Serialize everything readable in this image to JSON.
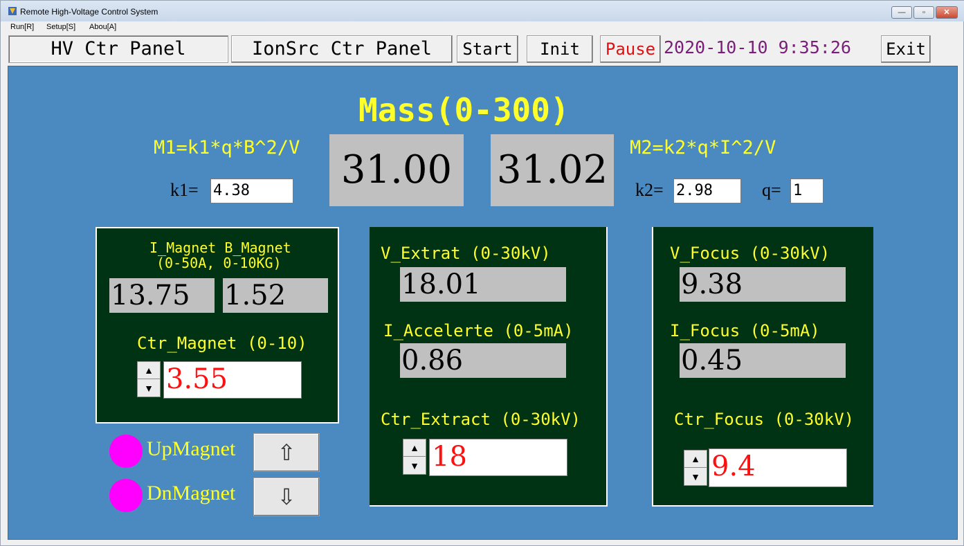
{
  "window": {
    "title": "Remote High-Voltage Control System",
    "minimize": "—",
    "maximize": "▫",
    "close": "✕"
  },
  "menu": [
    "Run[R]",
    "Setup[S]",
    "Abou[A]"
  ],
  "toolbar": {
    "hv_panel": "HV Ctr Panel",
    "ionsrc_panel": "IonSrc Ctr Panel",
    "start": "Start",
    "init": "Init",
    "pause": "Pause",
    "datetime": "2020-10-10 9:35:26",
    "exit": "Exit"
  },
  "mass": {
    "title": "Mass(0-300)",
    "m1_formula": "M1=k1*q*B^2/V",
    "m2_formula": "M2=k2*q*I^2/V",
    "m1_value": "31.00",
    "m2_value": "31.02",
    "k1_label": "k1=",
    "k1_value": "4.38",
    "k2_label": "k2=",
    "k2_value": "2.98",
    "q_label": "q=",
    "q_value": "1"
  },
  "magnet_panel": {
    "header_line1": "I_Magnet B_Magnet",
    "header_line2": "(0-50A, 0-10KG)",
    "i_magnet": "13.75",
    "b_magnet": "1.52",
    "ctr_label": "Ctr_Magnet (0-10)",
    "ctr_value": "3.55"
  },
  "magnet_buttons": {
    "up_label": "UpMagnet",
    "down_label": "DnMagnet",
    "up_icon": "⇧",
    "down_icon": "⇩"
  },
  "extract_panel": {
    "v_label": "V_Extrat (0-30kV)",
    "v_value": "18.01",
    "i_label": "I_Accelerte (0-5mA)",
    "i_value": "0.86",
    "ctr_label": "Ctr_Extract (0-30kV)",
    "ctr_value": "18"
  },
  "focus_panel": {
    "v_label": "V_Focus (0-30kV)",
    "v_value": "9.38",
    "i_label": "I_Focus (0-5mA)",
    "i_value": "0.45",
    "ctr_label": "Ctr_Focus (0-30kV)",
    "ctr_value": "9.4"
  },
  "spin_icons": {
    "up": "▲",
    "down": "▼"
  },
  "colors": {
    "main_bg": "#4a8ac0",
    "panel_bg": "#003214",
    "label": "#ffff2a",
    "setpoint": "#ff1010",
    "led": "#ff00ff",
    "datetime": "#7a1e7a",
    "pause": "#e01010"
  }
}
